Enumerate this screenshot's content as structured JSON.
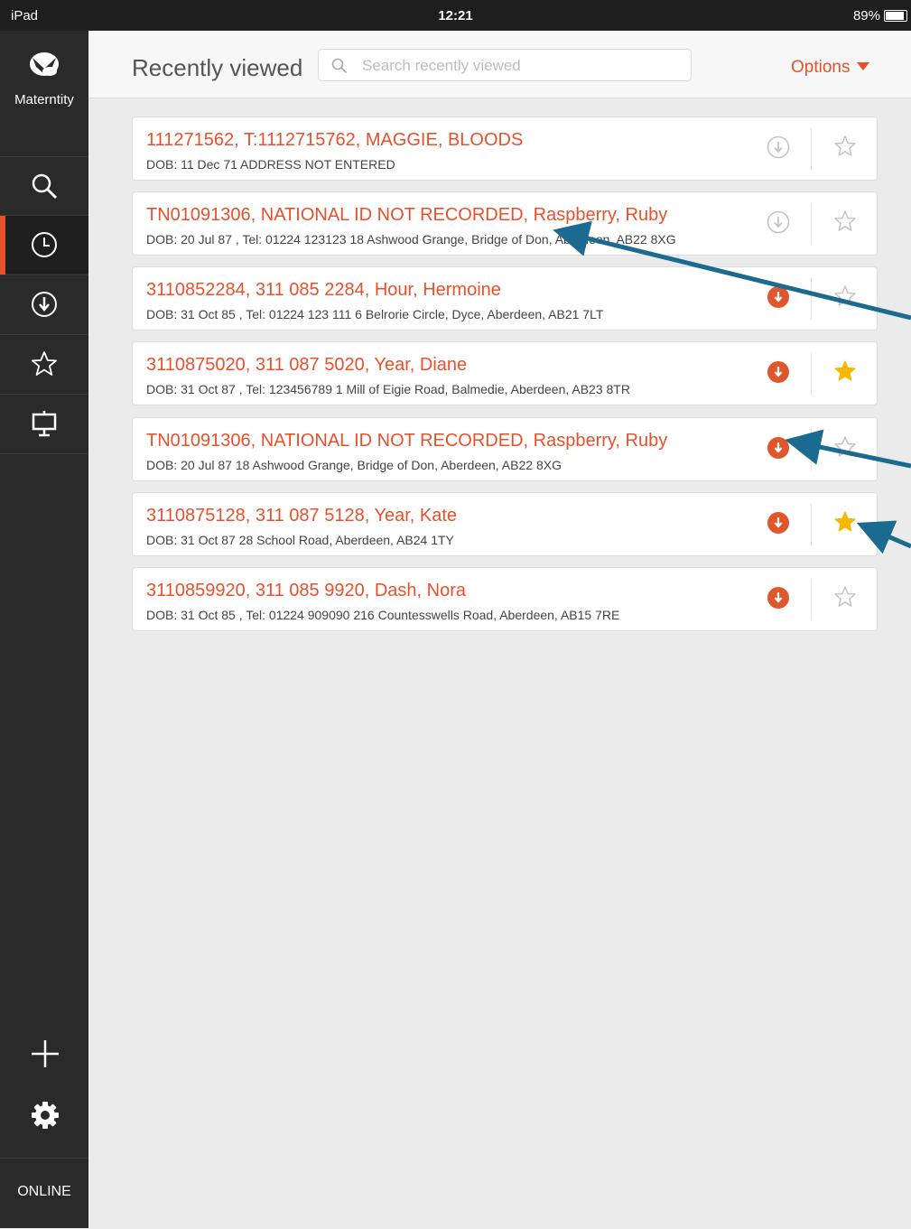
{
  "statusbar": {
    "device": "iPad",
    "time": "12:21",
    "battery": "89%"
  },
  "sidebar": {
    "brand": "Materntity",
    "items": [
      {
        "icon": "search-icon"
      },
      {
        "icon": "clock-icon",
        "active": true
      },
      {
        "icon": "download-icon"
      },
      {
        "icon": "star-icon"
      },
      {
        "icon": "presentation-icon"
      }
    ],
    "add_icon": "plus-icon",
    "settings_icon": "gear-icon",
    "status": "ONLINE"
  },
  "header": {
    "title": "Recently viewed",
    "search_placeholder": "Search recently viewed",
    "options_label": "Options"
  },
  "records": [
    {
      "title": "111271562, T:1112715762, MAGGIE, BLOODS",
      "details": "DOB: 11 Dec 71  ADDRESS NOT ENTERED",
      "downloaded": false,
      "favourite": false
    },
    {
      "title": "TN01091306, NATIONAL ID NOT RECORDED, Raspberry, Ruby",
      "details": "DOB: 20 Jul 87 , Tel: 01224 123123 18 Ashwood Grange, Bridge of Don, Aberdeen, AB22 8XG",
      "downloaded": false,
      "favourite": false
    },
    {
      "title": "3110852284, 311 085 2284, Hour, Hermoine",
      "details": "DOB: 31 Oct 85 , Tel: 01224 123 111 6 Belrorie Circle, Dyce, Aberdeen, AB21 7LT",
      "downloaded": true,
      "favourite": false
    },
    {
      "title": "3110875020, 311 087 5020, Year, Diane",
      "details": "DOB: 31 Oct 87 , Tel: 123456789 1 Mill of Eigie Road, Balmedie, Aberdeen, AB23 8TR",
      "downloaded": true,
      "favourite": true
    },
    {
      "title": "TN01091306, NATIONAL ID NOT RECORDED, Raspberry, Ruby",
      "details": "DOB: 20 Jul 87  18 Ashwood Grange, Bridge of Don, Aberdeen, AB22 8XG",
      "downloaded": true,
      "favourite": false
    },
    {
      "title": "3110875128, 311 087 5128, Year, Kate",
      "details": "DOB: 31 Oct 87  28 School Road, Aberdeen, AB24 1TY",
      "downloaded": true,
      "favourite": true
    },
    {
      "title": "3110859920, 311 085 9920, Dash, Nora",
      "details": "DOB: 31 Oct 85 , Tel: 01224 909090 216 Countesswells Road, Aberdeen, AB15 7RE",
      "downloaded": true,
      "favourite": false
    }
  ],
  "colors": {
    "accent": "#e8512b",
    "star": "#f5b800",
    "sidebar": "#2a2a2a",
    "annotation_arrow": "#1b6a8f"
  }
}
